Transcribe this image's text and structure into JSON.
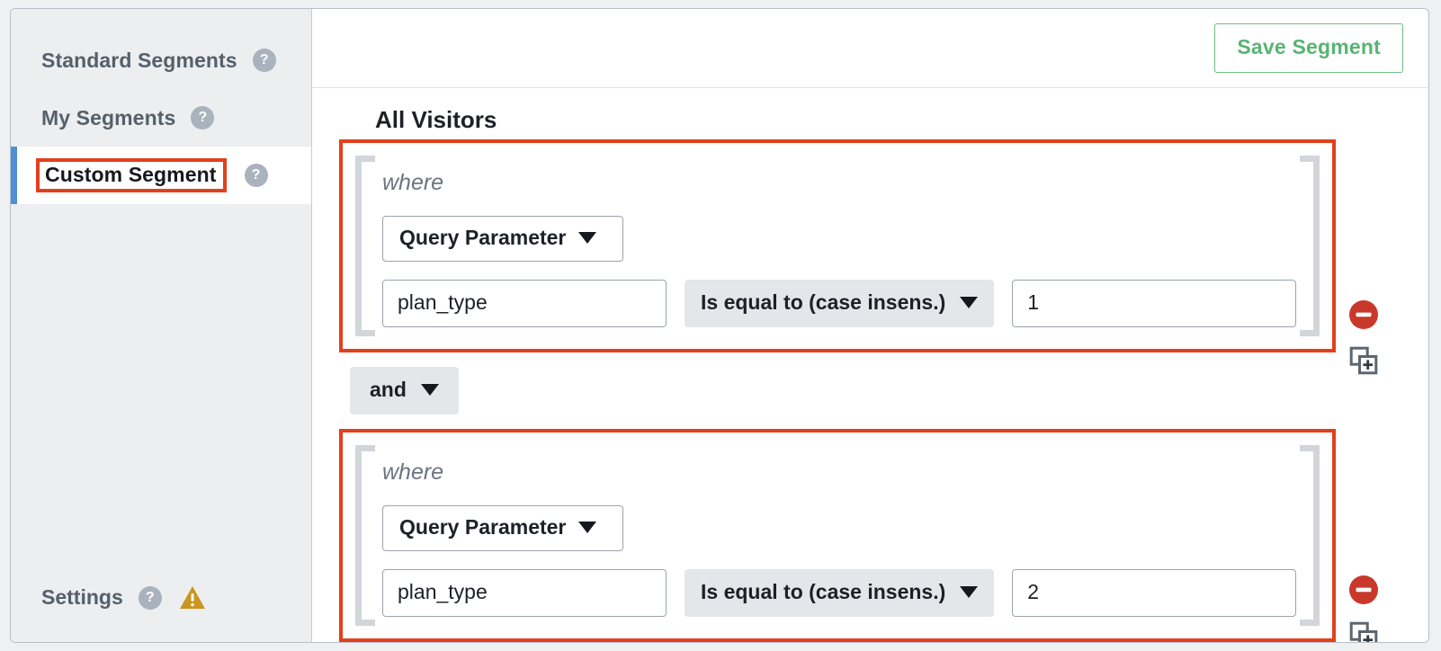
{
  "sidebar": {
    "items": [
      {
        "label": "Standard Segments",
        "help": "?",
        "active": false
      },
      {
        "label": "My Segments",
        "help": "?",
        "active": false
      },
      {
        "label": "Custom Segment",
        "help": "?",
        "active": true
      }
    ],
    "settings": {
      "label": "Settings",
      "help": "?",
      "warning_icon": "warning-triangle-icon"
    },
    "active_accent_color": "#4f8fd8",
    "highlight_color": "#e2401c"
  },
  "header": {
    "save_label": "Save Segment",
    "save_color": "#58b472"
  },
  "main": {
    "title": "All Visitors",
    "connector": {
      "label": "and",
      "caret": "▼"
    },
    "conditions": [
      {
        "where_label": "where",
        "dimension": "Query Parameter",
        "dimension_caret": "▼",
        "parameter_name": "plan_type",
        "operator": "Is equal to (case insens.)",
        "operator_caret": "▼",
        "value": "1",
        "remove_icon": "remove-circle-icon",
        "duplicate_icon": "duplicate-icon"
      },
      {
        "where_label": "where",
        "dimension": "Query Parameter",
        "dimension_caret": "▼",
        "parameter_name": "plan_type",
        "operator": "Is equal to (case insens.)",
        "operator_caret": "▼",
        "value": "2",
        "remove_icon": "remove-circle-icon",
        "duplicate_icon": "duplicate-icon"
      }
    ]
  }
}
